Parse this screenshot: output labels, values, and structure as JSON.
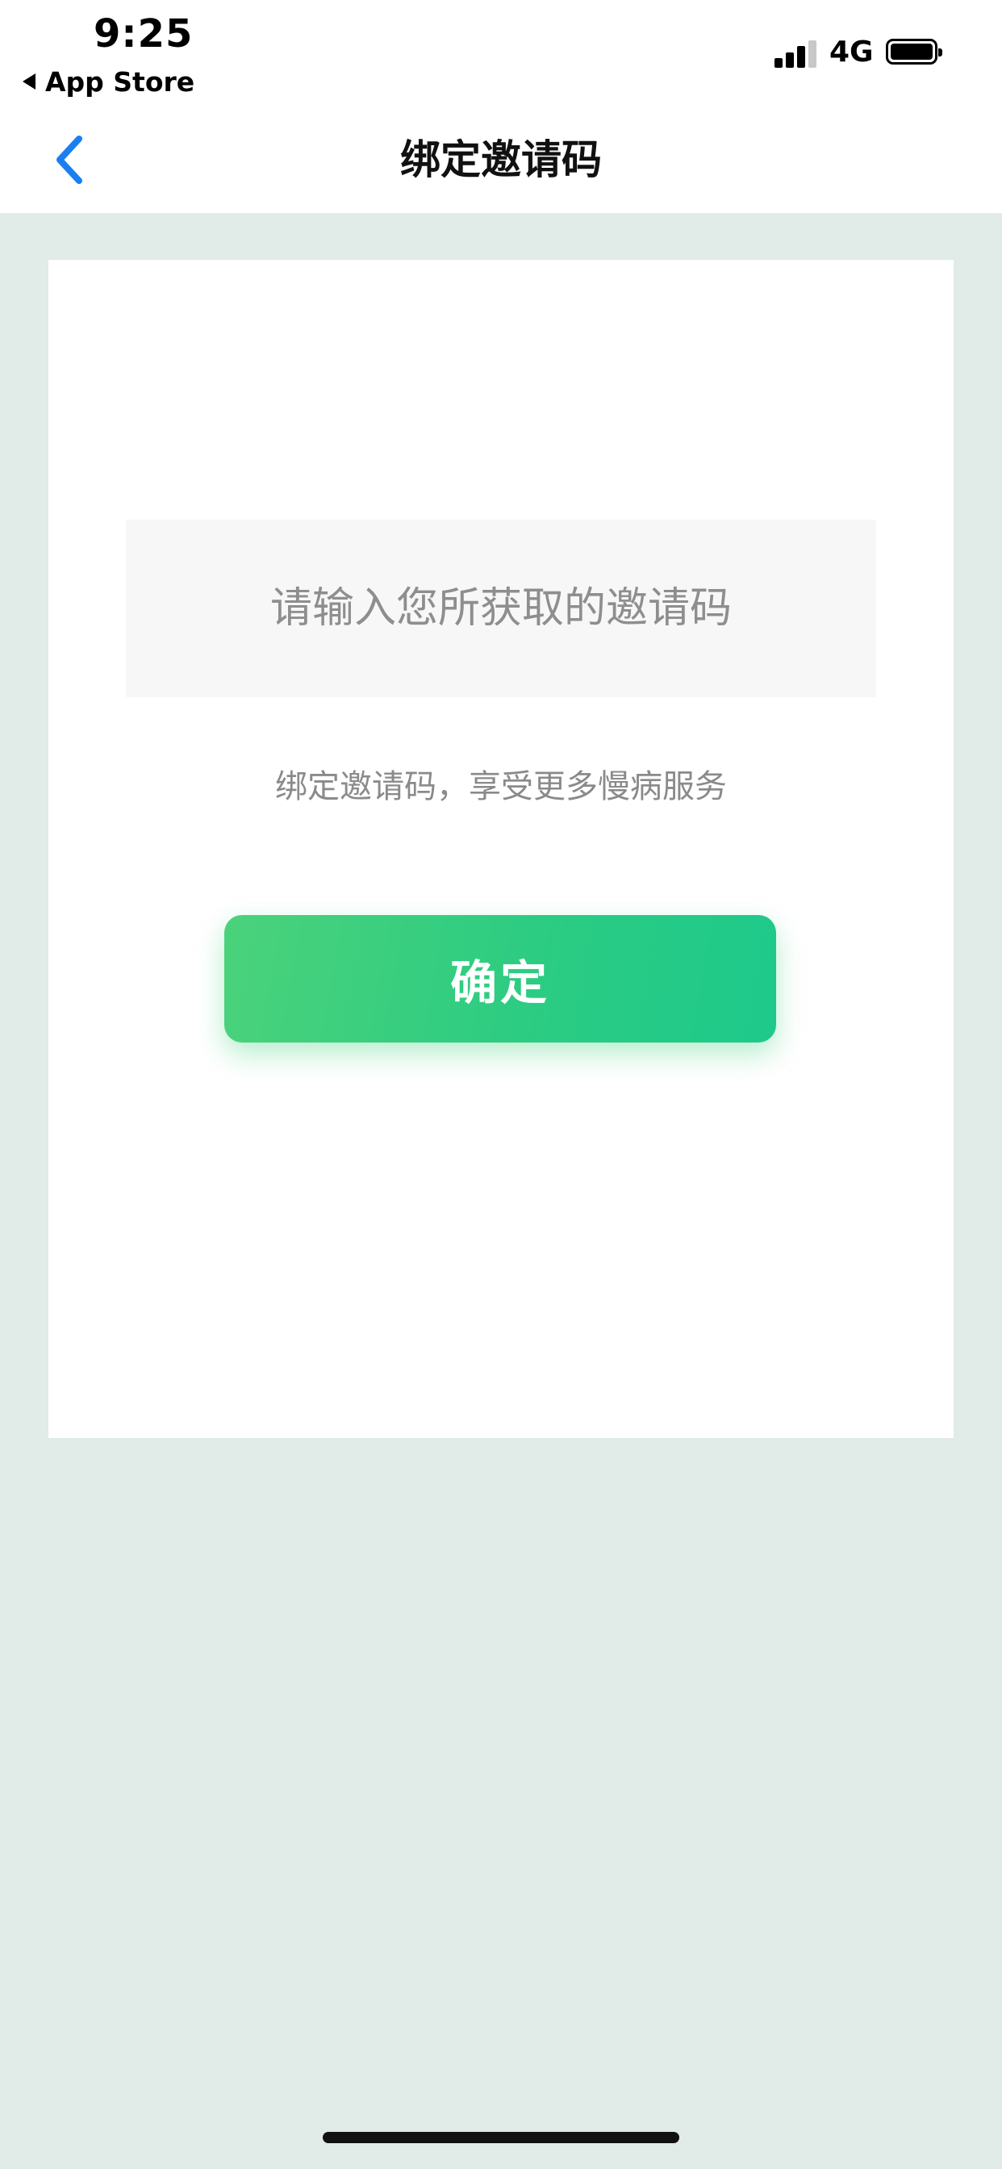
{
  "status_bar": {
    "time": "9:25",
    "back_app": "App Store",
    "network": "4G"
  },
  "nav": {
    "title": "绑定邀请码"
  },
  "form": {
    "input_placeholder": "请输入您所获取的邀请码",
    "input_value": "",
    "hint": "绑定邀请码，享受更多慢病服务",
    "confirm_label": "确定"
  },
  "colors": {
    "page_background": "#e1ebe7",
    "back_chevron": "#1a7ff0",
    "button_gradient_start": "#4bd27b",
    "button_gradient_end": "#1ec98b"
  },
  "icons": {
    "back": "chevron-left-icon",
    "signal": "signal-bars-icon",
    "battery": "battery-icon"
  }
}
